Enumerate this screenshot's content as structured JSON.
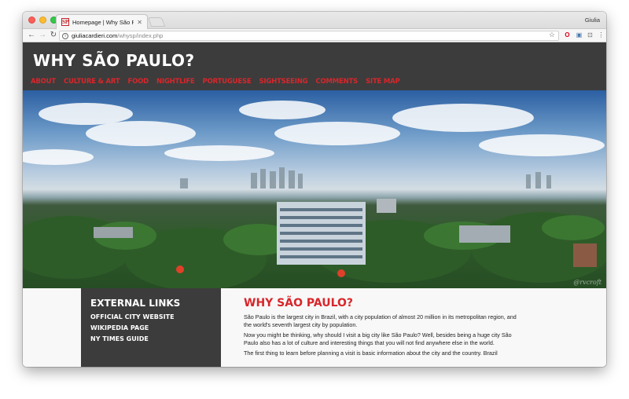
{
  "browser": {
    "tab_title": "Homepage | Why São Paulo?",
    "favicon_text": "SP",
    "profile_name": "Giulia",
    "url_host": "giuliacardieri.com",
    "url_path": "/whysp/index.php",
    "icons": [
      "back-icon",
      "forward-icon",
      "reload-icon",
      "info-icon",
      "star-icon",
      "opera-icon",
      "extension-icon",
      "cast-icon",
      "menu-icon"
    ]
  },
  "site": {
    "title": "WHY SÃO PAULO?",
    "accent_color": "#d8262b",
    "header_color": "#3c3c3c",
    "nav": [
      "ABOUT",
      "CULTURE & ART",
      "FOOD",
      "NIGHTLIFE",
      "PORTUGUESE",
      "SIGHTSEEING",
      "COMMENTS",
      "SITE MAP"
    ]
  },
  "hero": {
    "credit": "@rvcroft"
  },
  "sidebar": {
    "heading": "EXTERNAL LINKS",
    "links": [
      "OFFICIAL CITY WEBSITE",
      "WIKIPEDIA PAGE",
      "NY TIMES GUIDE"
    ]
  },
  "article": {
    "heading": "WHY SÃO PAULO?",
    "paragraphs": [
      "São Paulo is the largest city in Brazil, with a city population of almost 20 million in its metropolitan region, and the world's seventh largest city by population.",
      "Now you might be thinking, why should I visit a big city like São Paulo? Well, besides being a huge city São Paulo also has a lot of culture and interesting things that you will not find anywhere else in the world.",
      "The first thing to learn before planning a visit is basic information about the city and the country. Brazil"
    ]
  }
}
